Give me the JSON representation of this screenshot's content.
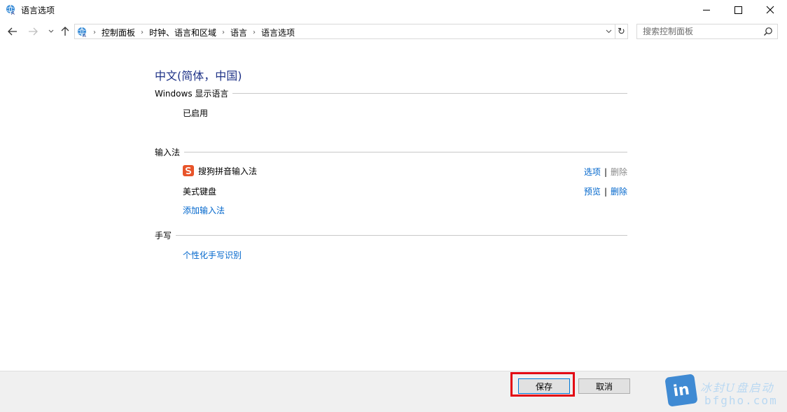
{
  "window": {
    "title": "语言选项"
  },
  "nav": {
    "breadcrumbs": [
      "控制面板",
      "时钟、语言和区域",
      "语言",
      "语言选项"
    ],
    "search_placeholder": "搜索控制面板"
  },
  "language": {
    "name": "中文(简体，中国)",
    "display_section": {
      "heading": "Windows 显示语言",
      "status": "已启用"
    },
    "input_section": {
      "heading": "输入法",
      "methods": [
        {
          "name": "搜狗拼音输入法",
          "action1": "选项",
          "action2": "删除",
          "action2_disabled": true
        },
        {
          "name": "美式键盘",
          "action1": "预览",
          "action2": "删除",
          "action2_disabled": false
        }
      ],
      "add_link": "添加输入法"
    },
    "handwriting_section": {
      "heading": "手写",
      "link": "个性化手写识别"
    }
  },
  "footer": {
    "save_label": "保存",
    "cancel_label": "取消",
    "watermark_line1": "冰封U盘启动",
    "watermark_line2": "bfgho.com"
  },
  "colors": {
    "link": "#0066cc",
    "title": "#1e3287",
    "highlight": "#e30613"
  }
}
